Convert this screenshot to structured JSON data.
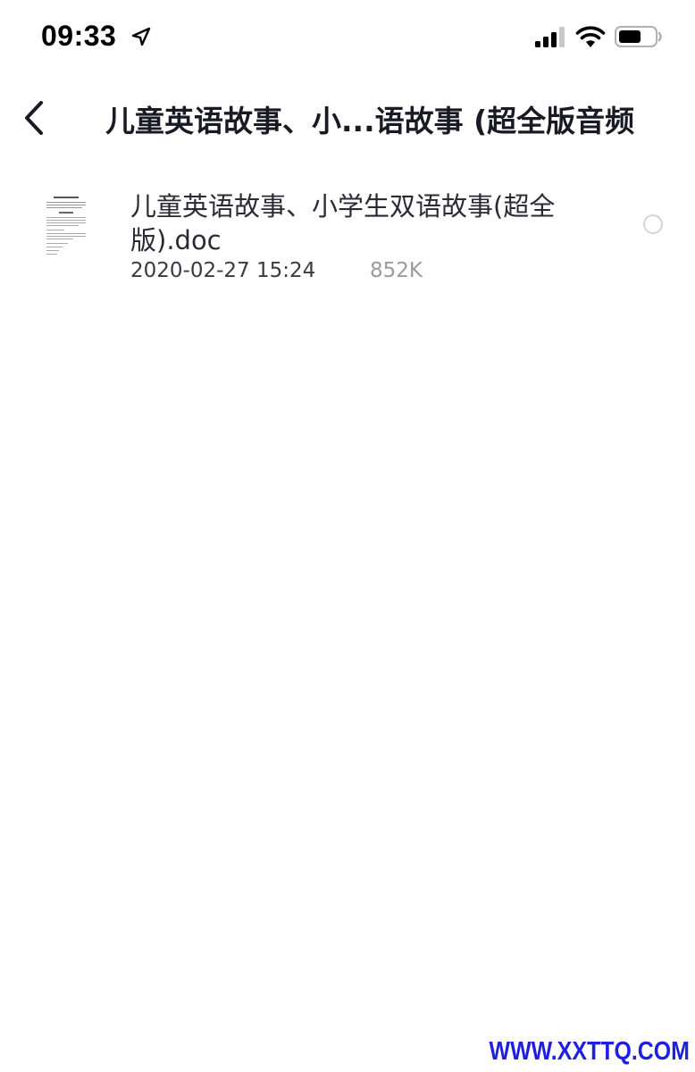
{
  "status_bar": {
    "time": "09:33",
    "icons": [
      "location-arrow-icon",
      "cellular-signal-icon",
      "wifi-icon",
      "battery-icon"
    ]
  },
  "nav": {
    "back_icon": "chevron-left-icon",
    "title": "儿童英语故事、小...语故事 (超全版音频"
  },
  "files": [
    {
      "name": "儿童英语故事、小学生双语故事(超全版).doc",
      "date": "2020-02-27 15:24",
      "size": "852K",
      "icon": "doc-thumbnail-icon"
    }
  ],
  "watermark": "WWW.XXTTQ.COM",
  "colors": {
    "watermark": "#1f1fe0",
    "size_text": "#9a9aa2",
    "radio_border": "#d4d4d8"
  }
}
